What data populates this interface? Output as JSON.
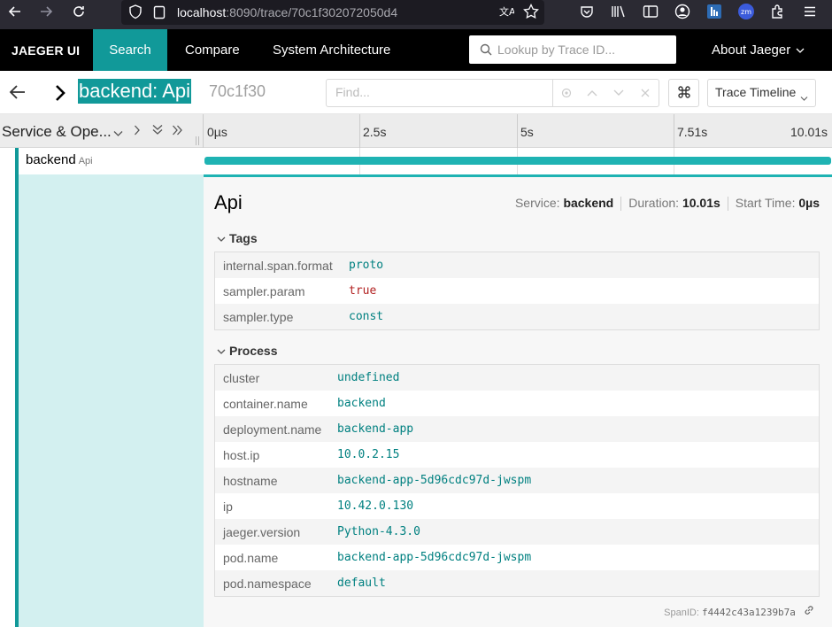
{
  "browser": {
    "url_host": "localhost",
    "url_rest": ":8090/trace/70c1f302072050d4"
  },
  "nav": {
    "brand": "JAEGER UI",
    "search": "Search",
    "compare": "Compare",
    "system_architecture": "System Architecture",
    "lookup_placeholder": "Lookup by Trace ID...",
    "about": "About Jaeger"
  },
  "trace": {
    "title": "backend: Api",
    "trace_id_short": "70c1f30",
    "find_placeholder": "Find...",
    "view_mode": "Trace Timeline"
  },
  "timeline": {
    "column_label": "Service & Ope...",
    "ticks": [
      "0µs",
      "2.5s",
      "5s",
      "7.51s",
      "10.01s"
    ]
  },
  "span": {
    "service": "backend",
    "operation": "Api",
    "duration_fraction": 1.0
  },
  "detail": {
    "title": "Api",
    "service_label": "Service:",
    "service_value": "backend",
    "duration_label": "Duration:",
    "duration_value": "10.01s",
    "start_label": "Start Time:",
    "start_value": "0µs",
    "tags_label": "Tags",
    "tags": [
      {
        "key": "internal.span.format",
        "value": "proto",
        "kind": "string"
      },
      {
        "key": "sampler.param",
        "value": "true",
        "kind": "bool"
      },
      {
        "key": "sampler.type",
        "value": "const",
        "kind": "string"
      }
    ],
    "process_label": "Process",
    "process": [
      {
        "key": "cluster",
        "value": "undefined"
      },
      {
        "key": "container.name",
        "value": "backend"
      },
      {
        "key": "deployment.name",
        "value": "backend-app"
      },
      {
        "key": "host.ip",
        "value": "10.0.2.15"
      },
      {
        "key": "hostname",
        "value": "backend-app-5d96cdc97d-jwspm"
      },
      {
        "key": "ip",
        "value": "10.42.0.130"
      },
      {
        "key": "jaeger.version",
        "value": "Python-4.3.0"
      },
      {
        "key": "pod.name",
        "value": "backend-app-5d96cdc97d-jwspm"
      },
      {
        "key": "pod.namespace",
        "value": "default"
      }
    ],
    "spanid_label": "SpanID:",
    "spanid_value": "f4442c43a1239b7a"
  },
  "colors": {
    "accent": "#119999",
    "bar": "#1fb3b3",
    "value": "#008080",
    "bool": "#b22222"
  }
}
